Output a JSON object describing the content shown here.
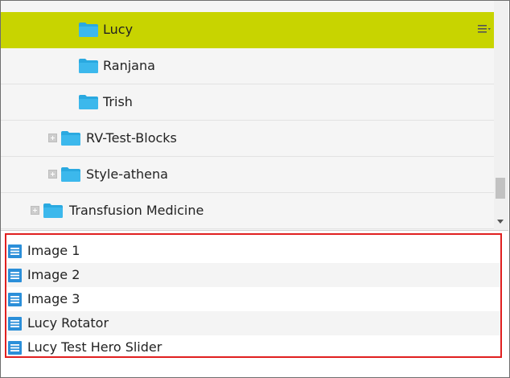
{
  "tree": {
    "items": [
      {
        "label": "Lucy",
        "selected": true
      },
      {
        "label": "Ranjana"
      },
      {
        "label": "Trish"
      },
      {
        "label": "RV-Test-Blocks",
        "expandable": true
      },
      {
        "label": "Style-athena",
        "expandable": true
      },
      {
        "label": "Transfusion Medicine",
        "expandable": true
      }
    ],
    "selected_color": "#c8d400",
    "folder_color": "#2aa9e0",
    "context_menu_icon": "hamburger-menu-icon"
  },
  "files": {
    "items": [
      {
        "label": "Image 1"
      },
      {
        "label": "Image 2"
      },
      {
        "label": "Image 3"
      },
      {
        "label": "Lucy Rotator"
      },
      {
        "label": "Lucy Test Hero Slider"
      }
    ],
    "icon": "document-icon",
    "icon_color": "#2b8fd9",
    "highlight_border_color": "#e02020"
  }
}
